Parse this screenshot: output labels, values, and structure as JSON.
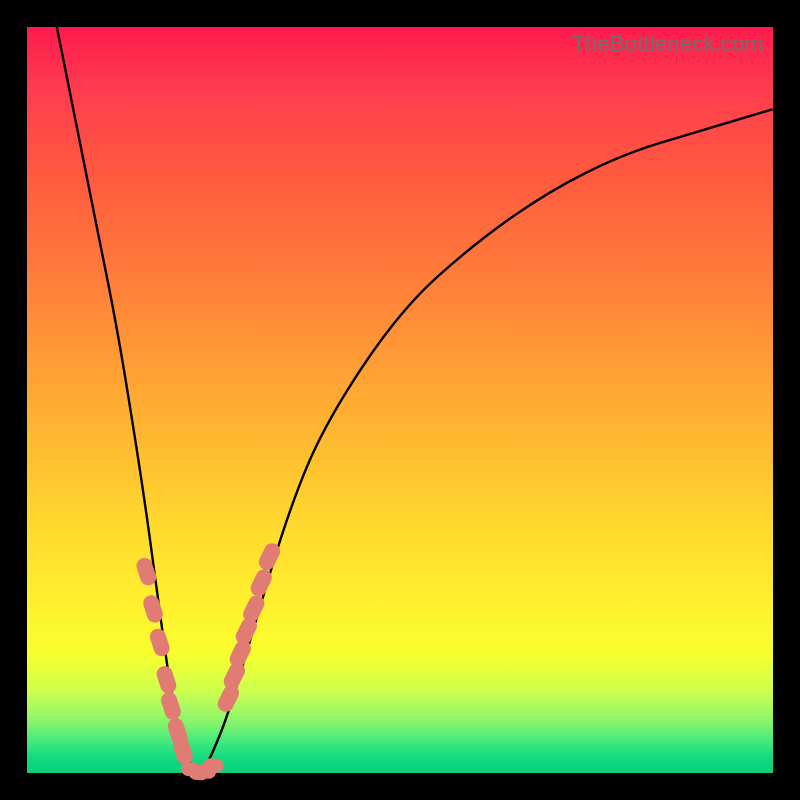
{
  "watermark": "TheBottleneck.com",
  "colors": {
    "background": "#000000",
    "curve": "#000000",
    "markers": "#e17c75",
    "gradient_stops": [
      "#ff1a4d",
      "#ff3b4f",
      "#ff5a3f",
      "#ff7e3a",
      "#ffb032",
      "#ffd92e",
      "#fff22e",
      "#f7ff2e",
      "#ccff4d",
      "#8bf56b",
      "#3de87f",
      "#10d97f",
      "#0ad07b"
    ]
  },
  "chart_data": {
    "type": "line",
    "title": "",
    "xlabel": "",
    "ylabel": "",
    "xlim": [
      0,
      100
    ],
    "ylim": [
      0,
      100
    ],
    "description": "V-shaped bottleneck curve over rainbow gradient; minimum (zero) near x≈23; left branch steep, right branch gradual; deviation from minimum increases monotonically away from x≈23.",
    "series": [
      {
        "name": "bottleneck-curve",
        "x": [
          4,
          6,
          8,
          10,
          12,
          14,
          16,
          18,
          19,
          20,
          21,
          22,
          23,
          24,
          25,
          27,
          30,
          35,
          40,
          50,
          60,
          70,
          80,
          90,
          100
        ],
        "y": [
          100,
          90,
          80,
          70,
          60,
          48,
          35,
          20,
          13,
          7,
          3,
          1,
          0,
          1,
          3,
          8,
          18,
          35,
          47,
          62,
          71,
          78,
          83,
          86,
          89
        ]
      },
      {
        "name": "markers-left-branch",
        "x": [
          16.0,
          16.9,
          17.8,
          18.7,
          19.3,
          20.2,
          20.9
        ],
        "y": [
          27.0,
          22.0,
          17.5,
          12.5,
          9.0,
          5.5,
          3.0
        ]
      },
      {
        "name": "markers-right-branch",
        "x": [
          27.0,
          27.8,
          28.6,
          29.4,
          30.4,
          31.4,
          32.5
        ],
        "y": [
          10.0,
          13.0,
          16.0,
          19.0,
          22.0,
          25.5,
          29.0
        ]
      },
      {
        "name": "markers-trough",
        "x": [
          22.0,
          23.0,
          24.0,
          25.0
        ],
        "y": [
          0.5,
          0.0,
          0.2,
          1.0
        ]
      }
    ]
  }
}
